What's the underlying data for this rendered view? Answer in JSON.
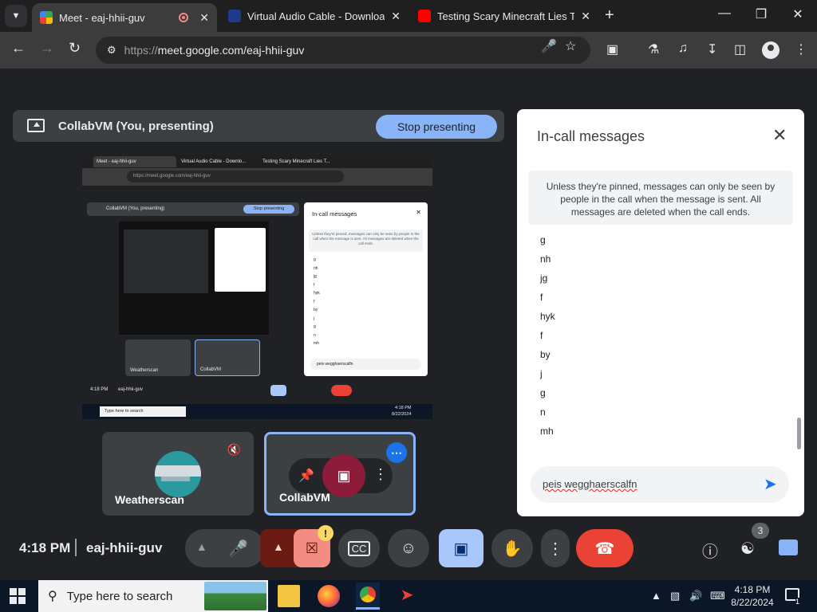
{
  "browser": {
    "tabs": [
      {
        "title": "Meet - eaj-hhii-guv",
        "active": true
      },
      {
        "title": "Virtual Audio Cable - Download",
        "active": false
      },
      {
        "title": "Testing Scary Minecraft Lies To",
        "active": false
      }
    ],
    "url_scheme": "https://",
    "url_host": "meet.google.com/eaj-hhii-guv"
  },
  "presentation": {
    "label": "CollabVM (You, presenting)",
    "stop_label": "Stop presenting"
  },
  "preview": {
    "tab1": "Meet - eaj-hhii-guv",
    "tab2": "Virtual Audio Cable - Downlo...",
    "tab3": "Testing Scary Minecraft Lies T...",
    "url": "https://meet.google.com/eaj-hhii-guv",
    "present_label": "CollabVM (You, presenting)",
    "stop_label": "Stop presenting",
    "chat_title": "In-call messages",
    "chat_note": "Unless they're pinned, messages can only be seen by people in the call when the message is sent. All messages are deleted when the call ends.",
    "messages": [
      "g",
      "nh",
      "jg",
      "f",
      "hyk",
      "f",
      "by",
      "j",
      "g",
      "n",
      "mh"
    ],
    "input": "peis wegghaerscalfn",
    "tile1": "Weatherscan",
    "tile2": "CollabVM",
    "clock": "4:18 PM",
    "code": "eaj-hhii-guv",
    "taskbar_search": "Type here to search",
    "time": "4:18 PM",
    "date": "8/22/2024"
  },
  "participants": [
    {
      "name": "Weatherscan",
      "mic_muted": true
    },
    {
      "name": "CollabVM",
      "presenting": true
    }
  ],
  "chat": {
    "title": "In-call messages",
    "note": "Unless they're pinned, messages can only be seen by people in the call when the message is sent. All messages are deleted when the call ends.",
    "messages": [
      "g",
      "nh",
      "jg",
      "f",
      "hyk",
      "f",
      "by",
      "j",
      "g",
      "n",
      "mh"
    ],
    "input_value": "peis wegghaerscalfn"
  },
  "bottom_bar": {
    "time": "4:18 PM",
    "meeting_code": "eaj-hhii-guv",
    "warning_badge": "!",
    "people_count": "3"
  },
  "taskbar": {
    "search_placeholder": "Type here to search",
    "time": "4:18 PM",
    "date": "8/22/2024",
    "notification_count": "1"
  },
  "colors": {
    "accent": "#8ab4f8",
    "end_call": "#ea4335",
    "camera_off": "#f28b82",
    "background": "#202124"
  }
}
